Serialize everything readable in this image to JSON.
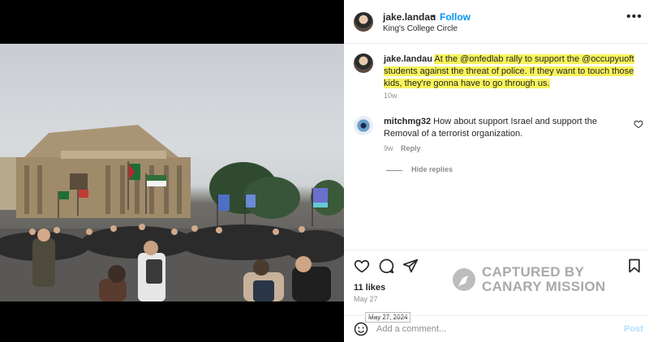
{
  "post": {
    "username": "jake.landau",
    "follow_label": "Follow",
    "dot": "•",
    "location": "King's College Circle",
    "more_icon": "more-horizontal-icon",
    "more_label": "•••"
  },
  "caption": {
    "username": "jake.landau",
    "text": "At the @onfedlab rally to support the @occupyuoft students against the threat of police. If they want to touch those kids, they're gonna have to go through us.",
    "time": "10w"
  },
  "comment": {
    "username": "mitchmg32",
    "text": "How about support Israel and support the Removal of a terrorist organization.",
    "time": "9w",
    "reply_label": "Reply"
  },
  "hide_replies_label": "Hide replies",
  "watermark": {
    "line1": "CAPTURED BY",
    "line2": "CANARY MISSION"
  },
  "likes": "11 likes",
  "date": "May 27",
  "date_tooltip": "May 27, 2024",
  "add_comment": {
    "placeholder": "Add a comment...",
    "post_label": "Post"
  },
  "colors": {
    "highlight": "#f7f35a",
    "follow_blue": "#0095f6",
    "post_disabled": "#b2dffc"
  }
}
